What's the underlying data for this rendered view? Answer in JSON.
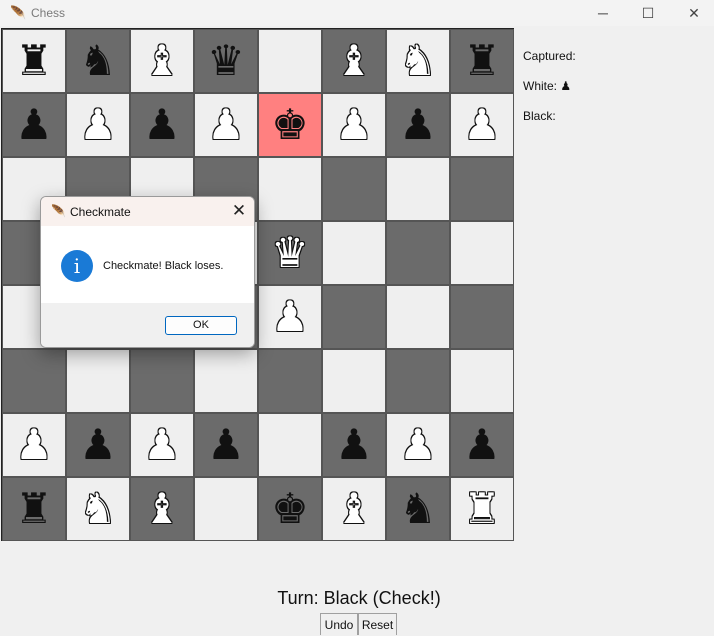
{
  "window": {
    "title": "Chess"
  },
  "board": {
    "rows": [
      [
        "br",
        "bn",
        "wb",
        "bq",
        "",
        "wb",
        "wn",
        "br"
      ],
      [
        "bp",
        "wp",
        "bp",
        "wp",
        "bk",
        "wp",
        "bp",
        "wp"
      ],
      [
        "",
        "",
        "",
        "",
        "",
        "",
        "",
        ""
      ],
      [
        "",
        "",
        "",
        "",
        "wq",
        "",
        "",
        ""
      ],
      [
        "",
        "",
        "",
        "",
        "wp",
        "",
        "",
        ""
      ],
      [
        "",
        "",
        "",
        "",
        "",
        "",
        "",
        ""
      ],
      [
        "wp",
        "bp",
        "wp",
        "bp",
        "",
        "bp",
        "wp",
        "bp"
      ],
      [
        "br",
        "wn",
        "wb",
        "",
        "bk",
        "wb",
        "bn",
        "wr"
      ]
    ],
    "highlight": {
      "row": 1,
      "col": 4
    },
    "colors": {
      "dark": "#6b6b6b",
      "light": "#efefef",
      "highlight": "#ff8080"
    }
  },
  "captured": {
    "title": "Captured:",
    "white": "White: ♟",
    "black": "Black:"
  },
  "status": {
    "turn": "Turn: Black (Check!)"
  },
  "controls": {
    "undo": "Undo",
    "reset": "Reset"
  },
  "dialog": {
    "title": "Checkmate",
    "message": "Checkmate! Black loses.",
    "ok": "OK",
    "icon": "info-icon"
  }
}
